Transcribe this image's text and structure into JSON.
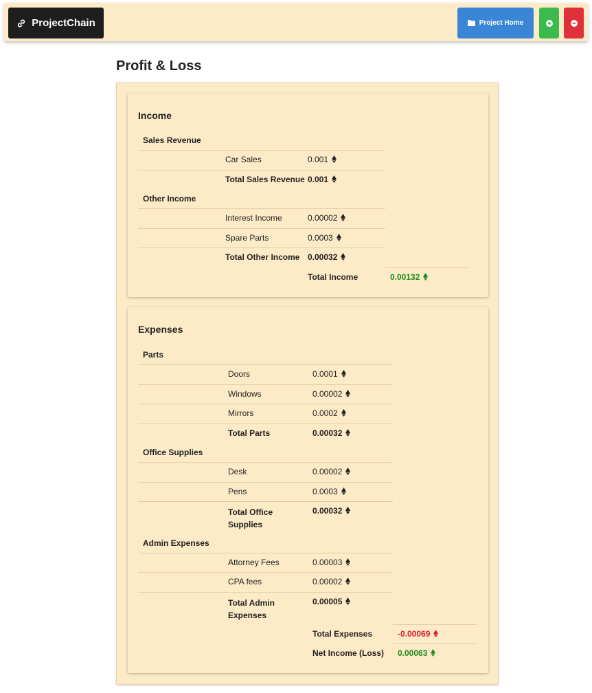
{
  "navbar": {
    "brand": "ProjectChain",
    "project_home_label": "Project Home"
  },
  "page_title": "Profit & Loss",
  "income": {
    "title": "Income",
    "groups": [
      {
        "name": "Sales Revenue",
        "items": [
          {
            "label": "Car Sales",
            "value": "0.001"
          }
        ],
        "total_label": "Total Sales Revenue",
        "total_value": "0.001"
      },
      {
        "name": "Other Income",
        "items": [
          {
            "label": "Interest Income",
            "value": "0.00002"
          },
          {
            "label": "Spare Parts",
            "value": "0.0003"
          }
        ],
        "total_label": "Total Other Income",
        "total_value": "0.00032"
      }
    ],
    "total_label": "Total Income",
    "total_value": "0.00132"
  },
  "expenses": {
    "title": "Expenses",
    "groups": [
      {
        "name": "Parts",
        "items": [
          {
            "label": "Doors",
            "value": "0.0001"
          },
          {
            "label": "Windows",
            "value": "0.00002"
          },
          {
            "label": "Mirrors",
            "value": "0.0002"
          }
        ],
        "total_label": "Total Parts",
        "total_value": "0.00032"
      },
      {
        "name": "Office Supplies",
        "items": [
          {
            "label": "Desk",
            "value": "0.00002"
          },
          {
            "label": "Pens",
            "value": "0.0003"
          }
        ],
        "total_label": "Total Office Supplies",
        "total_value": "0.00032"
      },
      {
        "name": "Admin Expenses",
        "items": [
          {
            "label": "Attorney Fees",
            "value": "0.00003"
          },
          {
            "label": "CPA fees",
            "value": "0.00002"
          }
        ],
        "total_label": "Total Admin Expenses",
        "total_value": "0.00005"
      }
    ],
    "total_label": "Total Expenses",
    "total_value": "-0.00069",
    "net_label": "Net Income (Loss)",
    "net_value": "0.00063"
  },
  "colors": {
    "background": "#fdebc8",
    "brand_bg": "#1e1e1e",
    "home_button": "#3a86d6",
    "add_button": "#3dba4e",
    "remove_button": "#e0303a",
    "positive": "#1f8a1f",
    "negative": "#d71e2d"
  },
  "icons": {
    "brand": "link-icon",
    "project_home": "folder-icon",
    "add": "plus-circle-icon",
    "remove": "minus-circle-icon",
    "currency": "ethereum-icon"
  }
}
